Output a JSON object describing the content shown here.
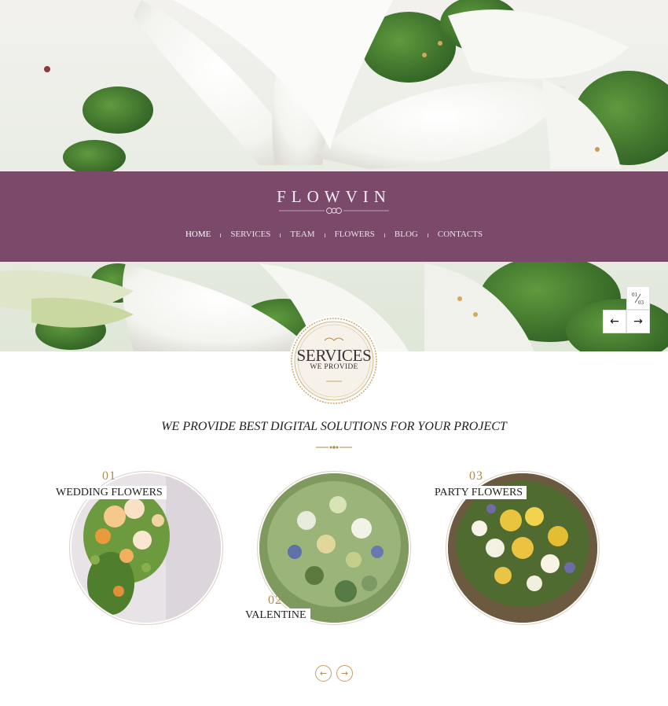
{
  "brand": {
    "logo_text": "FLOWVIN"
  },
  "nav": {
    "items": [
      {
        "label": "HOME",
        "active": true
      },
      {
        "label": "SERVICES"
      },
      {
        "label": "TEAM"
      },
      {
        "label": "FLOWERS"
      },
      {
        "label": "BLOG"
      },
      {
        "label": "CONTACTS"
      }
    ]
  },
  "slider": {
    "counter_current": "01",
    "counter_total": "03",
    "prev_icon": "arrow-left-icon",
    "next_icon": "arrow-right-icon"
  },
  "services_badge": {
    "title": "SERVICES",
    "subtitle": "WE PROVIDE"
  },
  "tagline": "WE PROVIDE BEST DIGITAL SOLUTIONS FOR YOUR PROJECT",
  "services": [
    {
      "number": "01",
      "label": "WEDDING FLOWERS"
    },
    {
      "number": "02",
      "label": "VALENTINE"
    },
    {
      "number": "03",
      "label": "PARTY FLOWERS"
    }
  ],
  "pagination": {
    "prev_icon": "arrow-left-icon",
    "next_icon": "arrow-right-icon"
  },
  "colors": {
    "nav_band": "#7b4a6b",
    "accent_gold": "#b08a48",
    "background": "#ffffff"
  }
}
